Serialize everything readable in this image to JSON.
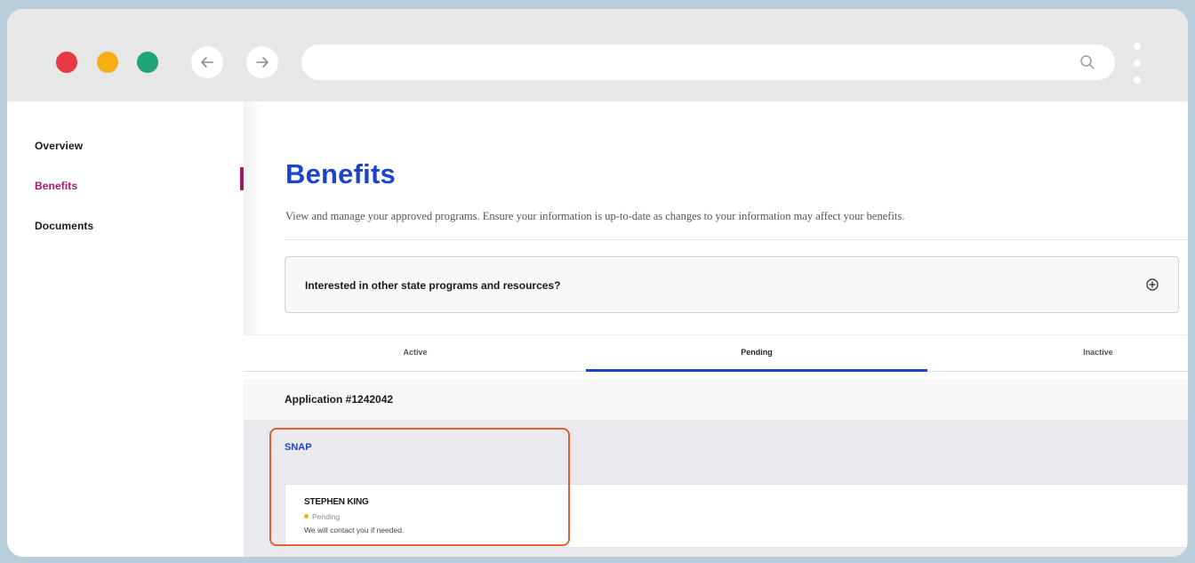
{
  "browser": {
    "url": "",
    "accent_colors": {
      "close": "#e63946",
      "minimize": "#f6ae13",
      "maximize": "#1ea676"
    }
  },
  "sidebar": {
    "items": [
      {
        "label": "Overview",
        "active": false
      },
      {
        "label": "Benefits",
        "active": true
      },
      {
        "label": "Documents",
        "active": false
      }
    ],
    "active_color": "#a2186c"
  },
  "main": {
    "title": "Benefits",
    "description": "View and manage your approved programs. Ensure your information is up-to-date as changes to your information may affect your benefits.",
    "accordion": {
      "label": "Interested in other state programs and resources?",
      "icon": "plus-circle-icon"
    },
    "tabs": [
      {
        "label": "Active",
        "active": false
      },
      {
        "label": "Pending",
        "active": true
      },
      {
        "label": "Inactive",
        "active": false
      }
    ],
    "application": {
      "label": "Application #1242042",
      "program": "SNAP",
      "card": {
        "name": "STEPHEN KING",
        "status": "Pending",
        "message": "We will contact you if needed."
      }
    },
    "brand_color": "#1b44c8",
    "highlight_color": "#e2612f"
  }
}
